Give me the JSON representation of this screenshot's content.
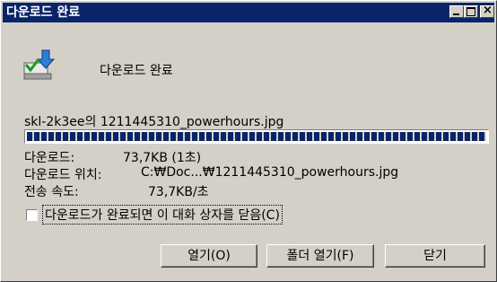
{
  "window": {
    "title": "다운로드 완료",
    "close_glyph": "×"
  },
  "header": {
    "text": "다운로드 완료"
  },
  "file": {
    "name": "skl-2k3ee의 1211445310_powerhours.jpg"
  },
  "progress": {
    "percent": 100
  },
  "info": [
    {
      "label": "다운로드:",
      "value": "73,7KB (1초)"
    },
    {
      "label": "다운로드 위치:",
      "value": "C:₩Doc...₩1211445310_powerhours.jpg"
    },
    {
      "label": "전송 속도:",
      "value": "73,7KB/초"
    }
  ],
  "checkbox": {
    "label": "다운로드가 완료되면 이 대화 상자를 닫음(C)",
    "checked": false
  },
  "buttons": {
    "open": "열기(O)",
    "open_folder": "폴더 열기(F)",
    "close": "닫기"
  },
  "icons": {
    "download": "download-computer-icon"
  },
  "colors": {
    "titlebar": "#0a246a",
    "progress": "#0a246a",
    "face": "#d4d0c8"
  }
}
